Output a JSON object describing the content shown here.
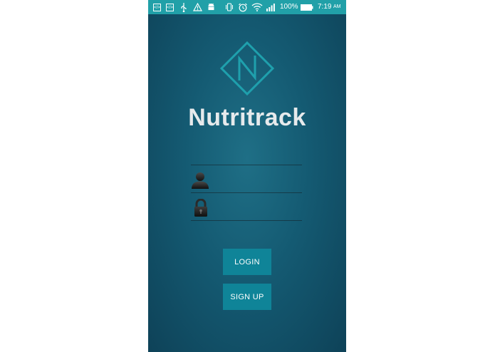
{
  "status_bar": {
    "icons_left": [
      "code-icon",
      "code-icon",
      "usb-icon",
      "warning-icon",
      "android-icon"
    ],
    "icons_right": [
      "vibrate-icon",
      "alarm-icon",
      "wifi-icon",
      "signal-icon",
      "battery-icon"
    ],
    "battery_level": "100%",
    "time": "7:19",
    "ampm": "AM"
  },
  "app": {
    "title": "Nutritrack"
  },
  "login_form": {
    "username": {
      "value": "",
      "placeholder": ""
    },
    "password": {
      "value": "",
      "placeholder": ""
    }
  },
  "buttons": {
    "login_label": "LOGIN",
    "signup_label": "SIGN UP"
  },
  "colors": {
    "status_bar": "#21a0a8",
    "background": "#145a72",
    "button": "#0f8498",
    "logo": "#1fa0ad",
    "title": "#e6eaec"
  }
}
